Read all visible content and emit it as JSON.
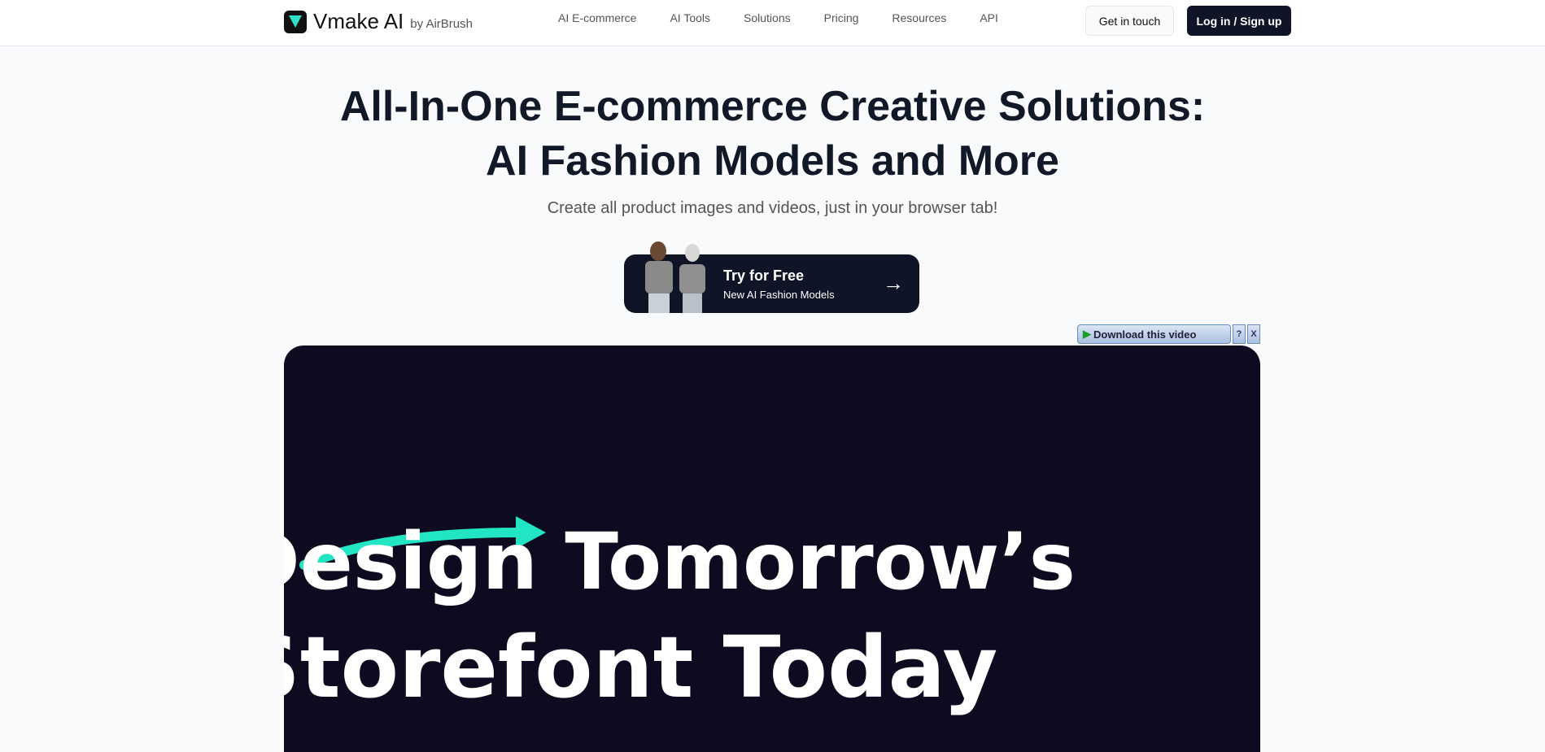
{
  "nav": {
    "brand": "Vmake AI",
    "by": "by AirBrush",
    "items": [
      "AI E-commerce",
      "AI Tools",
      "Solutions",
      "Pricing",
      "Resources",
      "API"
    ],
    "contact": "Get in touch",
    "login": "Log in / Sign up"
  },
  "hero": {
    "title_line1": "All-In-One E-commerce Creative Solutions:",
    "title_line2": "AI Fashion Models and More",
    "subtitle": "Create all product images and videos, just in your browser tab!",
    "cta_title": "Try for Free",
    "cta_sub": "New AI Fashion Models"
  },
  "download": {
    "label": "Download this video",
    "help": "?",
    "close": "X"
  },
  "video": {
    "line1": "Design Tomorrow’s",
    "line2": "Storefont Today",
    "accent": "#22e5c4",
    "bg": "#0d0b1f"
  }
}
